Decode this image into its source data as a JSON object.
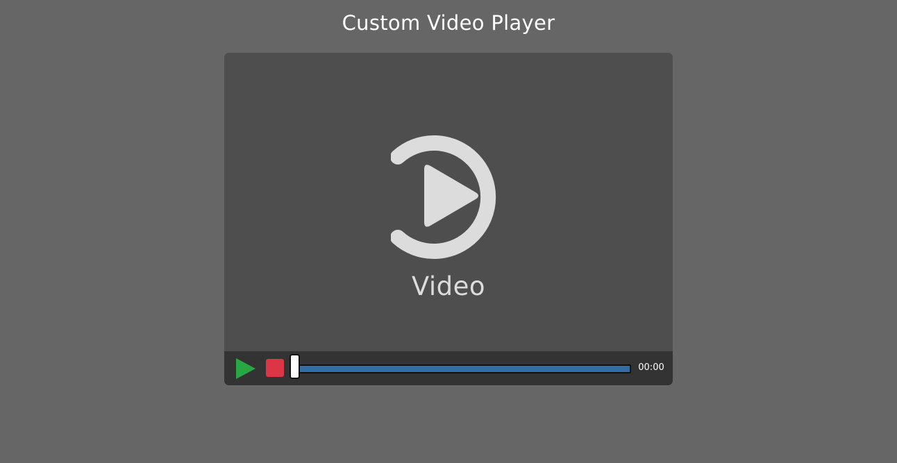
{
  "page": {
    "title": "Custom Video Player"
  },
  "video": {
    "placeholder_icon": "play-circle-icon",
    "placeholder_caption": "Video"
  },
  "controls": {
    "play_icon": "play-icon",
    "stop_icon": "stop-icon",
    "progress_fraction": 0,
    "timestamp": "00:00"
  },
  "colors": {
    "background": "#666666",
    "video_area": "#4e4e4e",
    "control_bar": "#333333",
    "play": "#28a745",
    "stop": "#dc3545",
    "progress_track": "#316ea6"
  }
}
